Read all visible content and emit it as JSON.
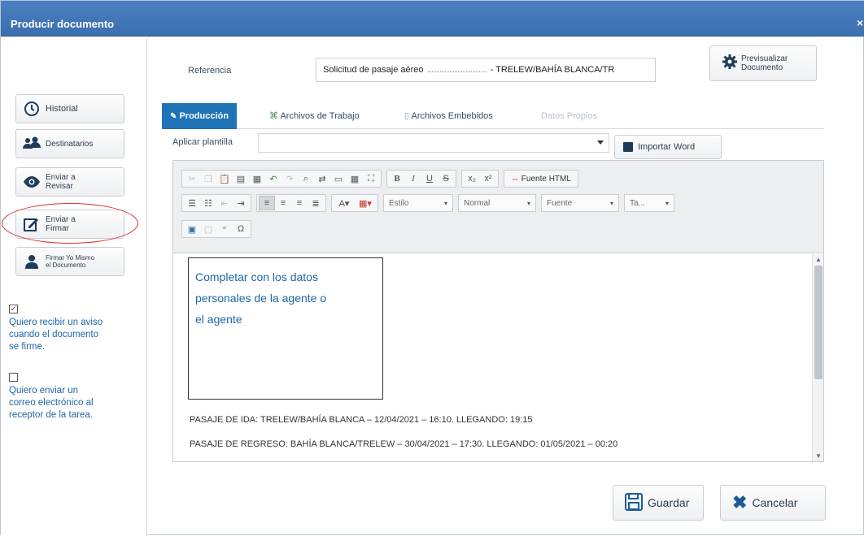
{
  "window": {
    "title": "Producir documento",
    "close_glyph": "×"
  },
  "left_panel": {
    "buttons": [
      {
        "label": "Historial",
        "icon": "clock-icon"
      },
      {
        "label": "Destinatarios",
        "icon": "users-icon"
      },
      {
        "label_l1": "Enviar a",
        "label_l2": "Revisar",
        "icon": "eye-icon"
      },
      {
        "label_l1": "Enviar a",
        "label_l2": "Firmar",
        "icon": "sign-icon"
      },
      {
        "label_l1": "Firmar Yo Mismo",
        "label_l2": "el Documento",
        "icon": "user-icon"
      }
    ],
    "checkboxes": [
      {
        "checked": true,
        "text_l1": "Quiero recibir un aviso",
        "text_l2": "cuando el documento",
        "text_l3": "se firme."
      },
      {
        "checked": false,
        "text_l1": "Quiero enviar un",
        "text_l2": "correo electrónico al",
        "text_l3": "receptor de la tarea."
      }
    ]
  },
  "reference": {
    "label": "Referencia",
    "value_prefix": "Solicitud de pasaje aéreo",
    "value_suffix": "- TRELEW/BAHÍA BLANCA/TR"
  },
  "preview": {
    "label_l1": "Previsualizar",
    "label_l2": "Documento"
  },
  "tabs": [
    {
      "label": "Producción",
      "state": "active"
    },
    {
      "label": "Archivos de Trabajo",
      "state": "normal"
    },
    {
      "label": "Archivos Embebidos",
      "state": "normal"
    },
    {
      "label": "Datos Propios",
      "state": "disabled"
    }
  ],
  "template": {
    "label": "Aplicar plantilla",
    "value": ""
  },
  "import_word": {
    "label": "Importar Word"
  },
  "toolbar": {
    "bold": "B",
    "italic": "I",
    "underline": "U",
    "strike": "S",
    "subscript": "x₂",
    "superscript": "x²",
    "html_source": "Fuente HTML",
    "style_combo": "Estilo",
    "format_combo": "Normal",
    "font_combo": "Fuente",
    "size_combo": "Ta...",
    "omega": "Ω"
  },
  "editor": {
    "note_l1": "Completar con los datos",
    "note_l2": "personales de la agente o",
    "note_l3": "el agente",
    "para1": "PASAJE DE IDA: TRELEW/BAHÍA BLANCA – 12/04/2021 – 16:10. LLEGANDO: 19:15",
    "para2": "PASAJE DE REGRESO: BAHÍA BLANCA/TRELEW – 30/04/2021 – 17:30. LLEGANDO: 01/05/2021 – 00:20"
  },
  "actions": {
    "save": "Guardar",
    "cancel": "Cancelar"
  },
  "colors": {
    "title_bar": "#3b6fae",
    "active_tab": "#1f73b7",
    "note_text": "#1f66a8",
    "highlight": "#d9312b",
    "cancel_icon": "#1e5a9a"
  }
}
